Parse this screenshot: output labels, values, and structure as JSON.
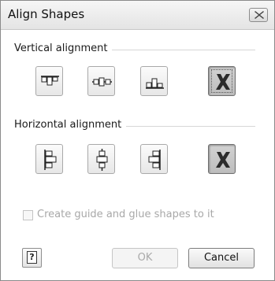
{
  "dialog": {
    "title": "Align Shapes",
    "close_icon": "close-x-icon"
  },
  "vertical": {
    "label": "Vertical alignment",
    "buttons": [
      {
        "name": "align-top",
        "icon": "align-top-icon"
      },
      {
        "name": "align-middle",
        "icon": "align-middle-icon"
      },
      {
        "name": "align-bottom",
        "icon": "align-bottom-icon"
      },
      {
        "name": "no-vertical-alignment",
        "icon": "no-alignment-x-icon",
        "selected": true
      }
    ]
  },
  "horizontal": {
    "label": "Horizontal alignment",
    "buttons": [
      {
        "name": "align-left",
        "icon": "align-left-icon"
      },
      {
        "name": "align-center",
        "icon": "align-center-icon"
      },
      {
        "name": "align-right",
        "icon": "align-right-icon"
      },
      {
        "name": "no-horizontal-alignment",
        "icon": "no-alignment-x-icon",
        "selected": true
      }
    ]
  },
  "guide_checkbox": {
    "label": "Create guide and glue shapes to it",
    "checked": false,
    "enabled": false
  },
  "footer": {
    "help_glyph": "?",
    "ok_label": "OK",
    "cancel_label": "Cancel"
  },
  "colors": {
    "disabled_text": "#a8a8a8",
    "x_mark": "#2b2b2b"
  }
}
